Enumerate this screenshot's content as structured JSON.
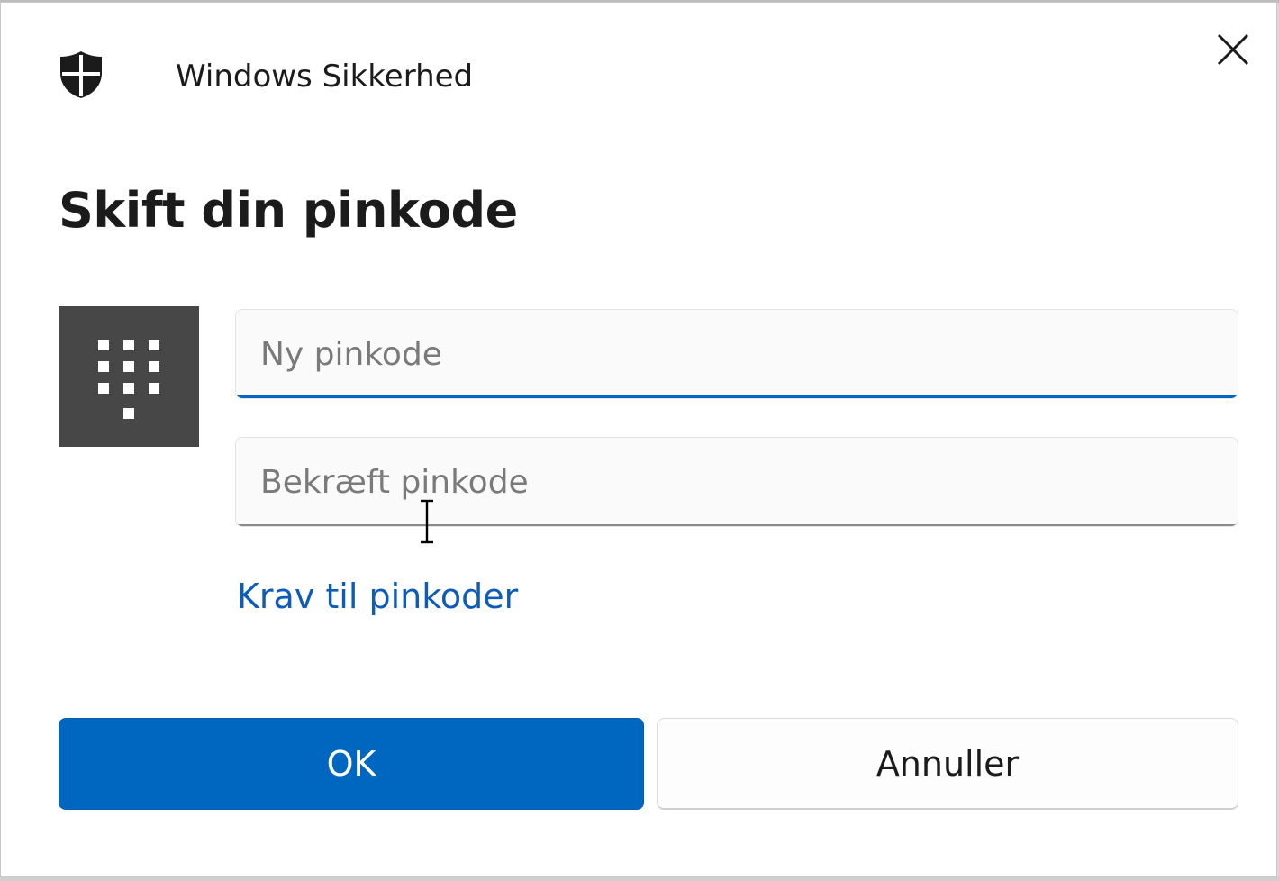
{
  "window": {
    "app_title": "Windows Sikkerhed",
    "close_label": "×",
    "shield_icon": "shield-icon",
    "close_icon": "close-icon"
  },
  "heading": "Skift din pinkode",
  "keypad_icon": "keypad-icon",
  "fields": {
    "new_pin": {
      "value": "",
      "placeholder": "Ny pinkode",
      "focused": true
    },
    "confirm_pin": {
      "value": "",
      "placeholder": "Bekræft pinkode",
      "focused": false
    }
  },
  "requirements_link": "Krav til pinkoder",
  "buttons": {
    "ok_label": "OK",
    "cancel_label": "Annuller"
  },
  "colors": {
    "accent": "#0067c0",
    "link": "#0f5cb8",
    "keypad_tile": "#474747",
    "text": "#1b1b1b"
  }
}
